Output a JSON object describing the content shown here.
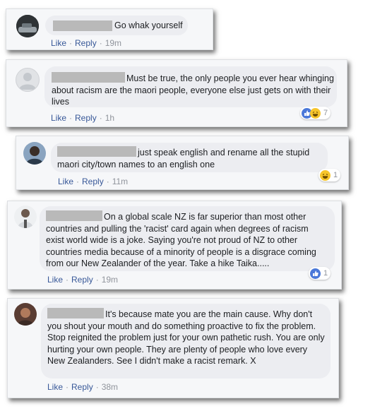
{
  "comments": [
    {
      "text": "Go whak yourself",
      "actions": {
        "like": "Like",
        "reply": "Reply",
        "time": "19m"
      }
    },
    {
      "text": "Must be true, the only people you ever hear whinging about racism are the maori people, everyone else just gets on with their lives",
      "actions": {
        "like": "Like",
        "reply": "Reply",
        "time": "1h"
      },
      "reaction": {
        "icons": [
          "like-icon",
          "haha-icon"
        ],
        "count": "7"
      }
    },
    {
      "text": "just speak english and rename all the stupid maori city/town names to an english one",
      "actions": {
        "like": "Like",
        "reply": "Reply",
        "time": "11m"
      },
      "reaction": {
        "icons": [
          "haha-icon"
        ],
        "count": "1"
      }
    },
    {
      "text": "On a global scale NZ is far superior than most other countries and pulling the 'racist' card again when degrees of racism exist world wide is a joke. Saying you're not proud of NZ to other countries media because of a minority of people is a disgrace coming from our New Zealander of the year. Take a hike Taika.....",
      "actions": {
        "like": "Like",
        "reply": "Reply",
        "time": "19m"
      },
      "reaction": {
        "icons": [
          "like-icon"
        ],
        "count": "1"
      }
    },
    {
      "text": "It's because mate you are the main cause. Why don't you shout your mouth and do something proactive to fix the problem. Stop reignited the problem just for your own pathetic rush. You are only hurting your own people. They are plenty of people who love every New Zealanders. See I didn't make a racist remark. X",
      "actions": {
        "like": "Like",
        "reply": "Reply",
        "time": "38m"
      }
    }
  ],
  "colors": {
    "link": "#385898",
    "muted": "#90949c",
    "bubble": "#ecedf1",
    "like": "#4a78d9",
    "haha": "#f7c52b"
  }
}
